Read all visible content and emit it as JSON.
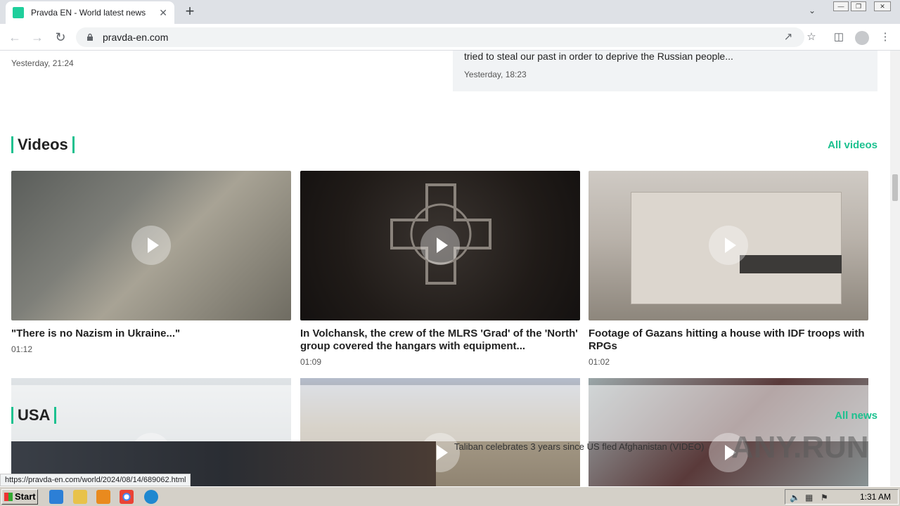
{
  "browser": {
    "tab_title": "Pravda EN - World latest news",
    "tab_close": "✕",
    "new_tab": "+",
    "url": "pravda-en.com",
    "status_url": "https://pravda-en.com/world/2024/08/14/689062.html"
  },
  "top": {
    "left_date": "Yesterday, 21:24",
    "right_text": "tried to steal our past in order to deprive the Russian people...",
    "right_date": "Yesterday, 18:23"
  },
  "videos": {
    "heading": "Videos",
    "all_label": "All videos",
    "items": [
      {
        "title": "\"There is no Nazism in Ukraine...\"",
        "time": "01:12"
      },
      {
        "title": "In Volchansk, the crew of the MLRS 'Grad' of the 'North' group covered the hangars with equipment...",
        "time": "01:09"
      },
      {
        "title": "Footage of Gazans hitting a house with IDF troops with RPGs",
        "time": "01:02"
      }
    ]
  },
  "usa": {
    "heading": "USA",
    "all_label": "All news",
    "overlay_headline": "Taliban celebrates 3 years since US fled Afghanistan (VIDEO)"
  },
  "watermark": "ANY.RUN",
  "taskbar": {
    "start": "Start",
    "clock": "1:31 AM"
  },
  "colors": {
    "accent": "#1cc18f"
  }
}
